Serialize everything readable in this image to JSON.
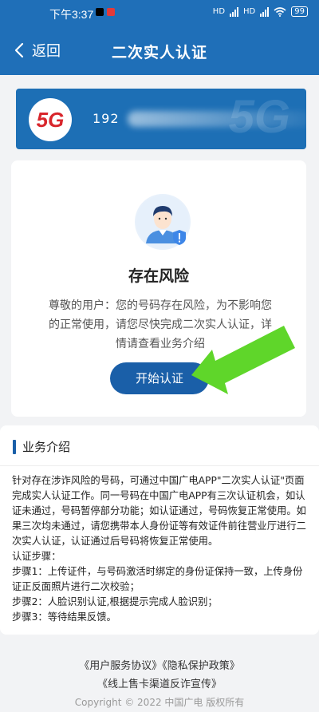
{
  "status_bar": {
    "time": "下午3:37",
    "signal_1": "HD",
    "signal_2": "HD",
    "battery": "99"
  },
  "navbar": {
    "back_label": "返回",
    "title": "二次实人认证"
  },
  "phone_card": {
    "logo_text": "5G",
    "bg_text": "5G",
    "number_prefix": "192"
  },
  "risk": {
    "title": "存在风险",
    "desc": "尊敬的用户：您的号码存在风险，为不影响您的正常使用，请您尽快完成二次实人认证，详情请查看业务介绍",
    "start_button": "开始认证"
  },
  "intro": {
    "title": "业务介绍",
    "lines": [
      "针对存在涉诈风险的号码，可通过中国广电APP\"二次实人认证\"页面完成实人认证工作。同一号码在中国广电APP有三次认证机会，如认证未通过，号码暂停部分功能；如认证通过，号码恢复正常使用。如果三次均未通过，请您携带本人身份证等有效证件前往营业厅进行二次实人认证，认证通过后号码将恢复正常使用。",
      "认证步骤：",
      "步骤1：上传证件，与号码激活时绑定的身份证保持一致，上传身份证正反面照片进行二次校验；",
      "步骤2：人脸识别认证,根据提示完成人脸识别；",
      "步骤3：等待结果反馈。"
    ]
  },
  "footer": {
    "user_agreement": "《用户服务协议》",
    "privacy_policy": "《隐私保护政策》",
    "anti_fraud": "《线上售卡渠道反诈宣传》",
    "copyright": "Copyright © 2022 中国广电 版权所有"
  },
  "colors": {
    "primary": "#1f6fb8",
    "button": "#1a5fa8",
    "arrow": "#5fd62a",
    "logo_red": "#d8262c",
    "logo_orange": "#f5a623"
  }
}
